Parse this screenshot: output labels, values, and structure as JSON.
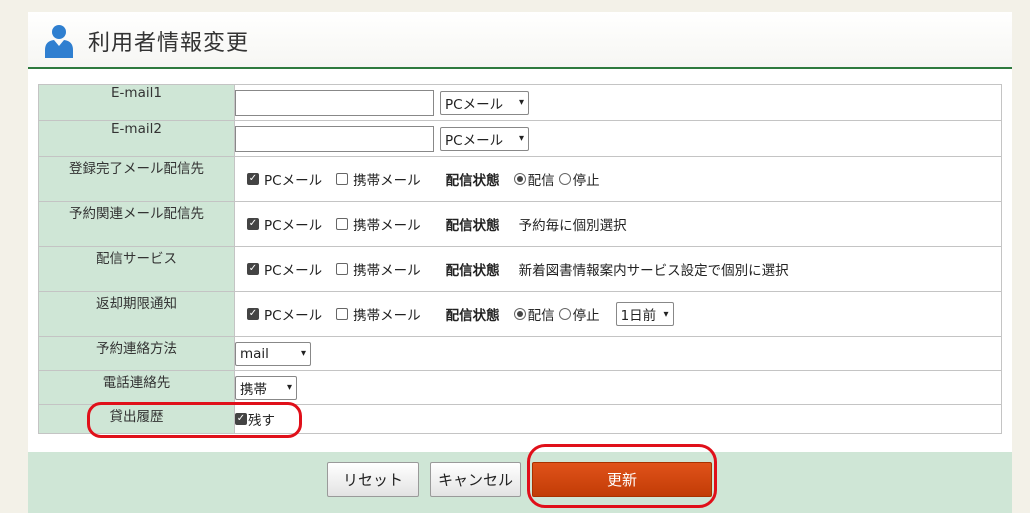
{
  "page": {
    "title": "利用者情報変更"
  },
  "email1": {
    "label": "E-mail1",
    "value": "",
    "select": "PCメール"
  },
  "email2": {
    "label": "E-mail2",
    "value": "",
    "select": "PCメール"
  },
  "registration_mail": {
    "label": "登録完了メール配信先",
    "pc": {
      "label": "PCメール",
      "checked": true
    },
    "mobile": {
      "label": "携帯メール",
      "checked": false
    },
    "status_label": "配信状態",
    "radio_on": {
      "label": "配信",
      "checked": true
    },
    "radio_off": {
      "label": "停止",
      "checked": false
    }
  },
  "reservation_mail": {
    "label": "予約関連メール配信先",
    "pc": {
      "label": "PCメール",
      "checked": true
    },
    "mobile": {
      "label": "携帯メール",
      "checked": false
    },
    "status_label": "配信状態",
    "status_text": "予約毎に個別選択"
  },
  "delivery_service": {
    "label": "配信サービス",
    "pc": {
      "label": "PCメール",
      "checked": true
    },
    "mobile": {
      "label": "携帯メール",
      "checked": false
    },
    "status_label": "配信状態",
    "status_text": "新着図書情報案内サービス設定で個別に選択"
  },
  "return_notice": {
    "label": "返却期限通知",
    "pc": {
      "label": "PCメール",
      "checked": true
    },
    "mobile": {
      "label": "携帯メール",
      "checked": false
    },
    "status_label": "配信状態",
    "radio_on": {
      "label": "配信",
      "checked": true
    },
    "radio_off": {
      "label": "停止",
      "checked": false
    },
    "timing": "1日前"
  },
  "contact_method": {
    "label": "予約連絡方法",
    "value": "mail"
  },
  "phone_contact": {
    "label": "電話連絡先",
    "value": "携帯"
  },
  "loan_history": {
    "label": "貸出履歴",
    "checkbox_label": "残す",
    "checked": true
  },
  "buttons": {
    "reset": "リセット",
    "cancel": "キャンセル",
    "update": "更新"
  },
  "colors": {
    "label_bg": "#cfe6d6",
    "header_rule": "#2e7a3e",
    "primary": "#d24a0f",
    "highlight": "#e0101a"
  },
  "icons": {
    "header": "user-icon",
    "checked": "checkbox-checked",
    "unchecked": "checkbox-unchecked",
    "select": "chevron-down-icon"
  }
}
